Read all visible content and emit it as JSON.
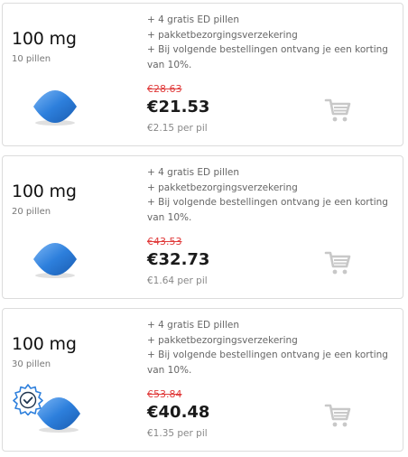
{
  "colors": {
    "accent_blue": "#2d7fdc",
    "strike_red": "#e03a3a",
    "cart_gray": "#c8c8c8"
  },
  "offers": [
    {
      "dose": "100 mg",
      "count": "10 pillen",
      "benefits": [
        "+ 4 gratis ED pillen",
        "+ pakketbezorgingsverzekering",
        "+ Bij volgende bestellingen ontvang je een korting",
        "van 10%."
      ],
      "old_price": "€28.63",
      "price": "€21.53",
      "per_pill": "€2.15 per pil",
      "icons": [
        "pill-icon",
        "cart-icon"
      ]
    },
    {
      "dose": "100 mg",
      "count": "20 pillen",
      "benefits": [
        "+ 4 gratis ED pillen",
        "+ pakketbezorgingsverzekering",
        "+ Bij volgende bestellingen ontvang je een korting",
        "van 10%."
      ],
      "old_price": "€43.53",
      "price": "€32.73",
      "per_pill": "€1.64 per pil",
      "icons": [
        "pill-icon",
        "cart-icon"
      ]
    },
    {
      "dose": "100 mg",
      "count": "30 pillen",
      "benefits": [
        "+ 4 gratis ED pillen",
        "+ pakketbezorgingsverzekering",
        "+ Bij volgende bestellingen ontvang je een korting",
        "van 10%."
      ],
      "old_price": "€53.84",
      "price": "€40.48",
      "per_pill": "€1.35 per pil",
      "icons": [
        "verified-badge-icon",
        "pill-icon",
        "cart-icon"
      ]
    }
  ]
}
